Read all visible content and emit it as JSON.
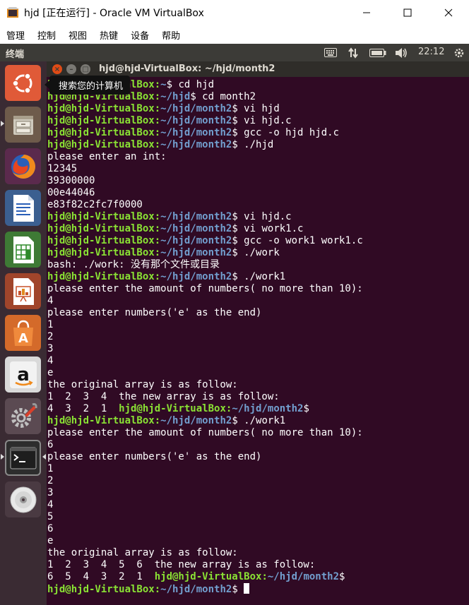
{
  "window": {
    "title": "hjd [正在运行] - Oracle VM VirtualBox",
    "minimize_label": "—",
    "maximize_label": "☐",
    "close_label": "✕"
  },
  "host_menu": [
    "管理",
    "控制",
    "视图",
    "热键",
    "设备",
    "帮助"
  ],
  "panel": {
    "app_title": "终端",
    "clock": "22:12",
    "indicators": [
      "keyboard-icon",
      "network-icon",
      "battery-icon",
      "volume-icon",
      "gear-icon"
    ]
  },
  "launcher": {
    "items": [
      "ubuntu-dash-icon",
      "files-icon",
      "firefox-icon",
      "writer-icon",
      "calc-icon",
      "impress-icon",
      "software-center-icon",
      "amazon-icon",
      "system-settings-icon",
      "terminal-icon",
      "dvd-icon"
    ],
    "tooltip": "搜索您的计算机"
  },
  "terminal": {
    "title": "hjd@hjd-VirtualBox: ~/hjd/month2",
    "lines": [
      {
        "user": "hjd@hjd-VirtualBox",
        "path": "~",
        "cmd": " cd hjd"
      },
      {
        "user": "hjd@hjd-VirtualBox",
        "path": "~/hjd",
        "cmd": " cd month2"
      },
      {
        "user": "hjd@hjd-VirtualBox",
        "path": "~/hjd/month2",
        "cmd": " vi hjd"
      },
      {
        "user": "hjd@hjd-VirtualBox",
        "path": "~/hjd/month2",
        "cmd": " vi hjd.c"
      },
      {
        "user": "hjd@hjd-VirtualBox",
        "path": "~/hjd/month2",
        "cmd": " gcc -o hjd hjd.c"
      },
      {
        "user": "hjd@hjd-VirtualBox",
        "path": "~/hjd/month2",
        "cmd": " ./hjd"
      },
      {
        "text": "please enter an int:"
      },
      {
        "text": "12345"
      },
      {
        "text": "39300000"
      },
      {
        "text": "00e44046"
      },
      {
        "text": "e83f82c2fc7f0000"
      },
      {
        "user": "hjd@hjd-VirtualBox",
        "path": "~/hjd/month2",
        "cmd": " vi hjd.c"
      },
      {
        "user": "hjd@hjd-VirtualBox",
        "path": "~/hjd/month2",
        "cmd": " vi work1.c"
      },
      {
        "user": "hjd@hjd-VirtualBox",
        "path": "~/hjd/month2",
        "cmd": " gcc -o work1 work1.c"
      },
      {
        "user": "hjd@hjd-VirtualBox",
        "path": "~/hjd/month2",
        "cmd": " ./work"
      },
      {
        "text": "bash: ./work: 没有那个文件或目录"
      },
      {
        "user": "hjd@hjd-VirtualBox",
        "path": "~/hjd/month2",
        "cmd": " ./work1"
      },
      {
        "text": "please enter the amount of numbers( no more than 10):"
      },
      {
        "text": "4"
      },
      {
        "text": "please enter numbers('e' as the end)"
      },
      {
        "text": "1"
      },
      {
        "text": "2"
      },
      {
        "text": "3"
      },
      {
        "text": "4"
      },
      {
        "text": "e"
      },
      {
        "text": "the original array is as follow:"
      },
      {
        "text": "1  2  3  4  the new array is as follow:"
      },
      {
        "text": "4  3  2  1  ",
        "user": "hjd@hjd-VirtualBox",
        "path": "~/hjd/month2",
        "cmd": ""
      },
      {
        "user": "hjd@hjd-VirtualBox",
        "path": "~/hjd/month2",
        "cmd": " ./work1"
      },
      {
        "text": "please enter the amount of numbers( no more than 10):"
      },
      {
        "text": "6"
      },
      {
        "text": "please enter numbers('e' as the end)"
      },
      {
        "text": "1"
      },
      {
        "text": "2"
      },
      {
        "text": "3"
      },
      {
        "text": "4"
      },
      {
        "text": "5"
      },
      {
        "text": "6"
      },
      {
        "text": "e"
      },
      {
        "text": "the original array is as follow:"
      },
      {
        "text": "1  2  3  4  5  6  the new array is as follow:"
      },
      {
        "text": "6  5  4  3  2  1  ",
        "user": "hjd@hjd-VirtualBox",
        "path": "~/hjd/month2",
        "cmd": ""
      },
      {
        "user": "hjd@hjd-VirtualBox",
        "path": "~/hjd/month2",
        "cmd": " ",
        "cursor": true
      }
    ]
  },
  "colors": {
    "terminal_bg": "#300a24",
    "prompt_user": "#8ae234",
    "prompt_path": "#729fcf",
    "launcher_bg": "#3a2b33",
    "panel_bg": "#3c3b37"
  }
}
